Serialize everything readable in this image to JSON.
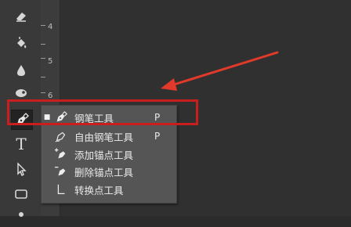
{
  "ruler": {
    "marks": [
      "4",
      "5",
      "6"
    ]
  },
  "toolbar": {
    "tools": [
      {
        "name": "eraser-icon"
      },
      {
        "name": "paint-bucket-icon"
      },
      {
        "name": "blur-drop-icon"
      },
      {
        "name": "dodge-icon"
      },
      {
        "name": "pen-tool-icon",
        "active": true
      },
      {
        "name": "type-tool-icon",
        "glyph": "T"
      },
      {
        "name": "path-selection-icon"
      },
      {
        "name": "rectangle-shape-icon"
      }
    ]
  },
  "flyout": {
    "items": [
      {
        "label": "钢笔工具",
        "shortcut": "P",
        "selected": true
      },
      {
        "label": "自由钢笔工具",
        "shortcut": "P"
      },
      {
        "label": "添加锚点工具",
        "shortcut": ""
      },
      {
        "label": "删除锚点工具",
        "shortcut": ""
      },
      {
        "label": "转换点工具",
        "shortcut": ""
      }
    ]
  },
  "annotation": {
    "highlight_color": "#c81e1e",
    "arrow_color": "#e23a2a"
  }
}
